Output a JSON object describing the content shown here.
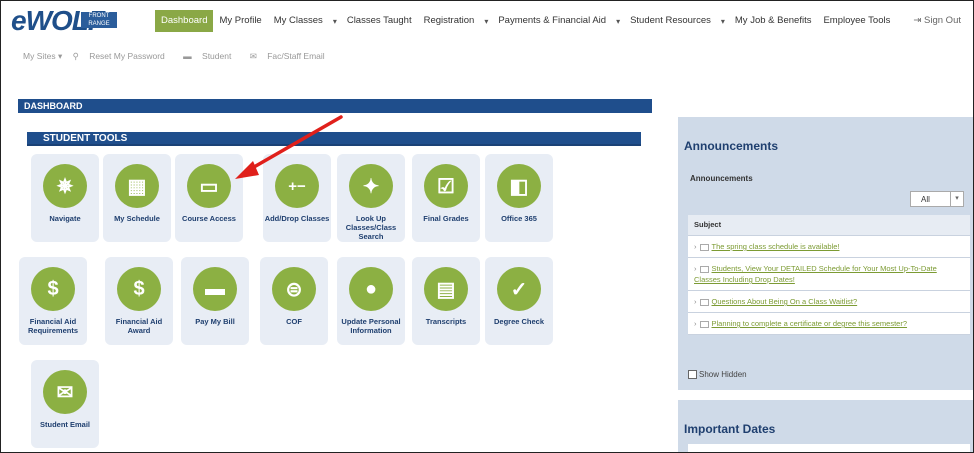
{
  "logo": {
    "text": "eWOLF",
    "badge": "FRONT RANGE"
  },
  "nav": {
    "items": [
      "Dashboard",
      "My Profile",
      "My Classes",
      "Classes Taught",
      "Registration",
      "Payments & Financial Aid",
      "Student Resources",
      "My Job & Benefits",
      "Employee Tools"
    ],
    "caret": "▾",
    "sign_out": "Sign Out"
  },
  "subnav": {
    "my_sites": "My Sites ▾",
    "reset": "Reset My Password",
    "student": "Student",
    "email": "Fac/Staff Email"
  },
  "dashboard": {
    "title": "DASHBOARD",
    "tools_title": "STUDENT TOOLS"
  },
  "tiles": [
    {
      "label": "Navigate",
      "icon": "✵"
    },
    {
      "label": "My Schedule",
      "icon": "▦"
    },
    {
      "label": "Course Access",
      "icon": "▭"
    },
    {
      "label": "Add/Drop Classes",
      "icon": "+−"
    },
    {
      "label": "Look Up Classes/Class Search",
      "icon": "✦"
    },
    {
      "label": "Final Grades",
      "icon": "☑"
    },
    {
      "label": "Office 365",
      "icon": "◧"
    },
    {
      "label": "Financial Aid Requirements",
      "icon": "$"
    },
    {
      "label": "Financial Aid Award",
      "icon": "$"
    },
    {
      "label": "Pay My Bill",
      "icon": "▬"
    },
    {
      "label": "COF",
      "icon": "⊜"
    },
    {
      "label": "Update Personal Information",
      "icon": "●"
    },
    {
      "label": "Transcripts",
      "icon": "▤"
    },
    {
      "label": "Degree Check",
      "icon": "✓"
    },
    {
      "label": "Student Email",
      "icon": "✉"
    }
  ],
  "announcements": {
    "title": "Announcements",
    "subtitle": "Announcements",
    "filter": "All",
    "column": "Subject",
    "items": [
      "The spring class schedule is available!",
      "Students, View Your DETAILED Schedule for Your Most Up-To-Date Classes Including Drop Dates!",
      "Questions About Being On a Class Waitlist?",
      "Planning to complete a certificate or degree this semester?"
    ],
    "show_hidden": "Show Hidden"
  },
  "important_dates": {
    "title": "Important Dates"
  },
  "colors": {
    "brand_blue": "#1f4e8c",
    "accent_green": "#8cb043",
    "panel": "#cfdae8"
  }
}
